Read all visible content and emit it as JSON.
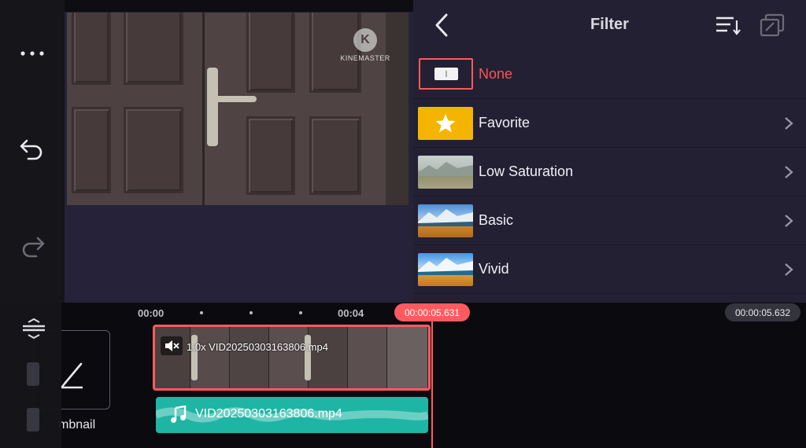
{
  "filter_panel": {
    "title": "Filter",
    "items": [
      {
        "label": "None",
        "selected": true,
        "has_chevron": false
      },
      {
        "label": "Favorite",
        "selected": false,
        "has_chevron": true
      },
      {
        "label": "Low Saturation",
        "selected": false,
        "has_chevron": true
      },
      {
        "label": "Basic",
        "selected": false,
        "has_chevron": true
      },
      {
        "label": "Vivid",
        "selected": false,
        "has_chevron": true
      }
    ]
  },
  "preview": {
    "watermark_text": "KINEMASTER",
    "watermark_letter": "K"
  },
  "timeline": {
    "ruler": [
      "00:00",
      "00:04"
    ],
    "playhead_time": "00:00:05.631",
    "end_time": "00:00:05.632",
    "thumbnail_label": "mbnail",
    "video_clip_label": "1.0x VID20250303163806.mp4",
    "audio_clip_label": "VID20250303163806.mp4"
  },
  "colors": {
    "accent": "#ff5a5f",
    "panel": "#242033",
    "audio": "#1fb5a5",
    "favorite": "#f5b400"
  }
}
